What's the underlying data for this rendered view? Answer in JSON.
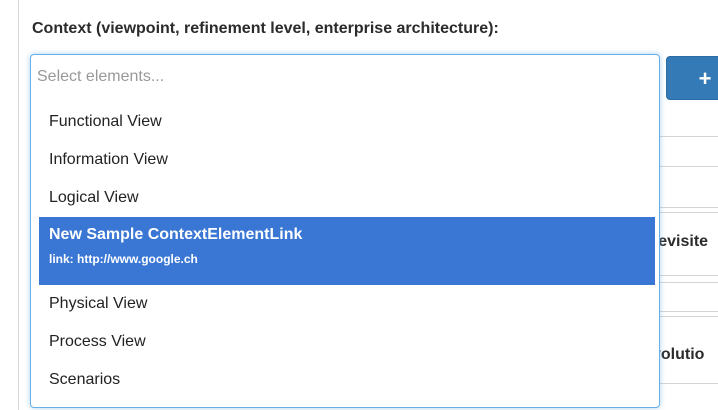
{
  "form": {
    "context_label": "Context (viewpoint, refinement level, enterprise architecture):",
    "select_placeholder": "Select elements...",
    "add_button_symbol": "+"
  },
  "dropdown": {
    "options": [
      {
        "label": "Functional View"
      },
      {
        "label": "Information View"
      },
      {
        "label": "Logical View"
      },
      {
        "label": "New Sample ContextElementLink",
        "description": "link: http://www.google.ch",
        "highlighted": true
      },
      {
        "label": "Physical View"
      },
      {
        "label": "Process View"
      },
      {
        "label": "Scenarios"
      }
    ]
  },
  "background": {
    "partial_text_1": "revisite",
    "partial_text_2": "volutio"
  },
  "colors": {
    "highlight": "#3a77d4",
    "button": "#337ab7",
    "focus_border": "#66afe9"
  }
}
